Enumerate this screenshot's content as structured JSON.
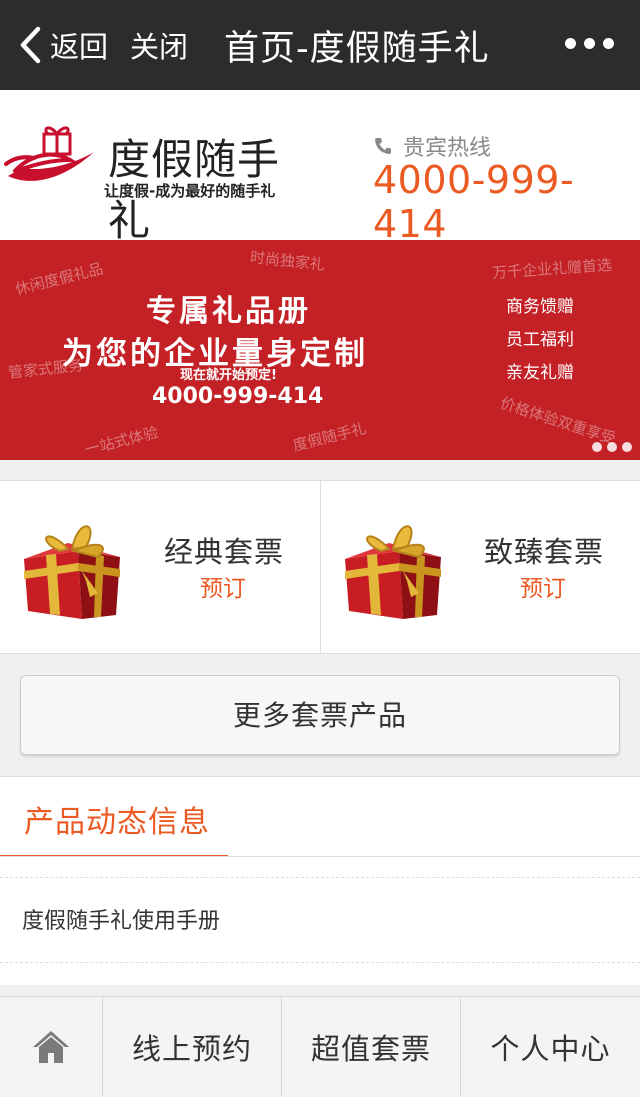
{
  "nav": {
    "back_label": "返回",
    "close_label": "关闭",
    "title": "首页-度假随手礼"
  },
  "header": {
    "logo_name": "度假随手礼",
    "logo_slogan": "让度假-成为最好的随手礼",
    "hotline_label": "贵宾热线",
    "hotline_number": "4000-999-414"
  },
  "banner": {
    "title_line1": "专属礼品册",
    "title_line2": "为您的企业量身定制",
    "subtitle": "现在就开始预定!",
    "phone": "4000-999-414",
    "list": [
      "商务馈赠",
      "员工福利",
      "亲友礼赠"
    ],
    "watermarks": [
      "休闲度假礼品",
      "时尚独家礼",
      "万千企业礼赠首选",
      "管家式服务",
      "一站式体验",
      "度假随手礼",
      "价格体验双重享受"
    ],
    "dots_count": 3
  },
  "products": [
    {
      "name": "经典套票",
      "action": "预订"
    },
    {
      "name": "致臻套票",
      "action": "预订"
    }
  ],
  "more_button_label": "更多套票产品",
  "news": {
    "tab_label": "产品动态信息",
    "items": [
      "度假随手礼使用手册"
    ]
  },
  "tabbar": {
    "items": [
      "线上预约",
      "超值套票",
      "个人中心"
    ]
  },
  "colors": {
    "accent": "#ec5a24",
    "banner_red": "#c42126",
    "navbar": "#2c2c2e"
  },
  "icons": [
    "back-chevron-icon",
    "more-dots-icon",
    "phone-icon",
    "gift-box-icon",
    "home-icon"
  ]
}
